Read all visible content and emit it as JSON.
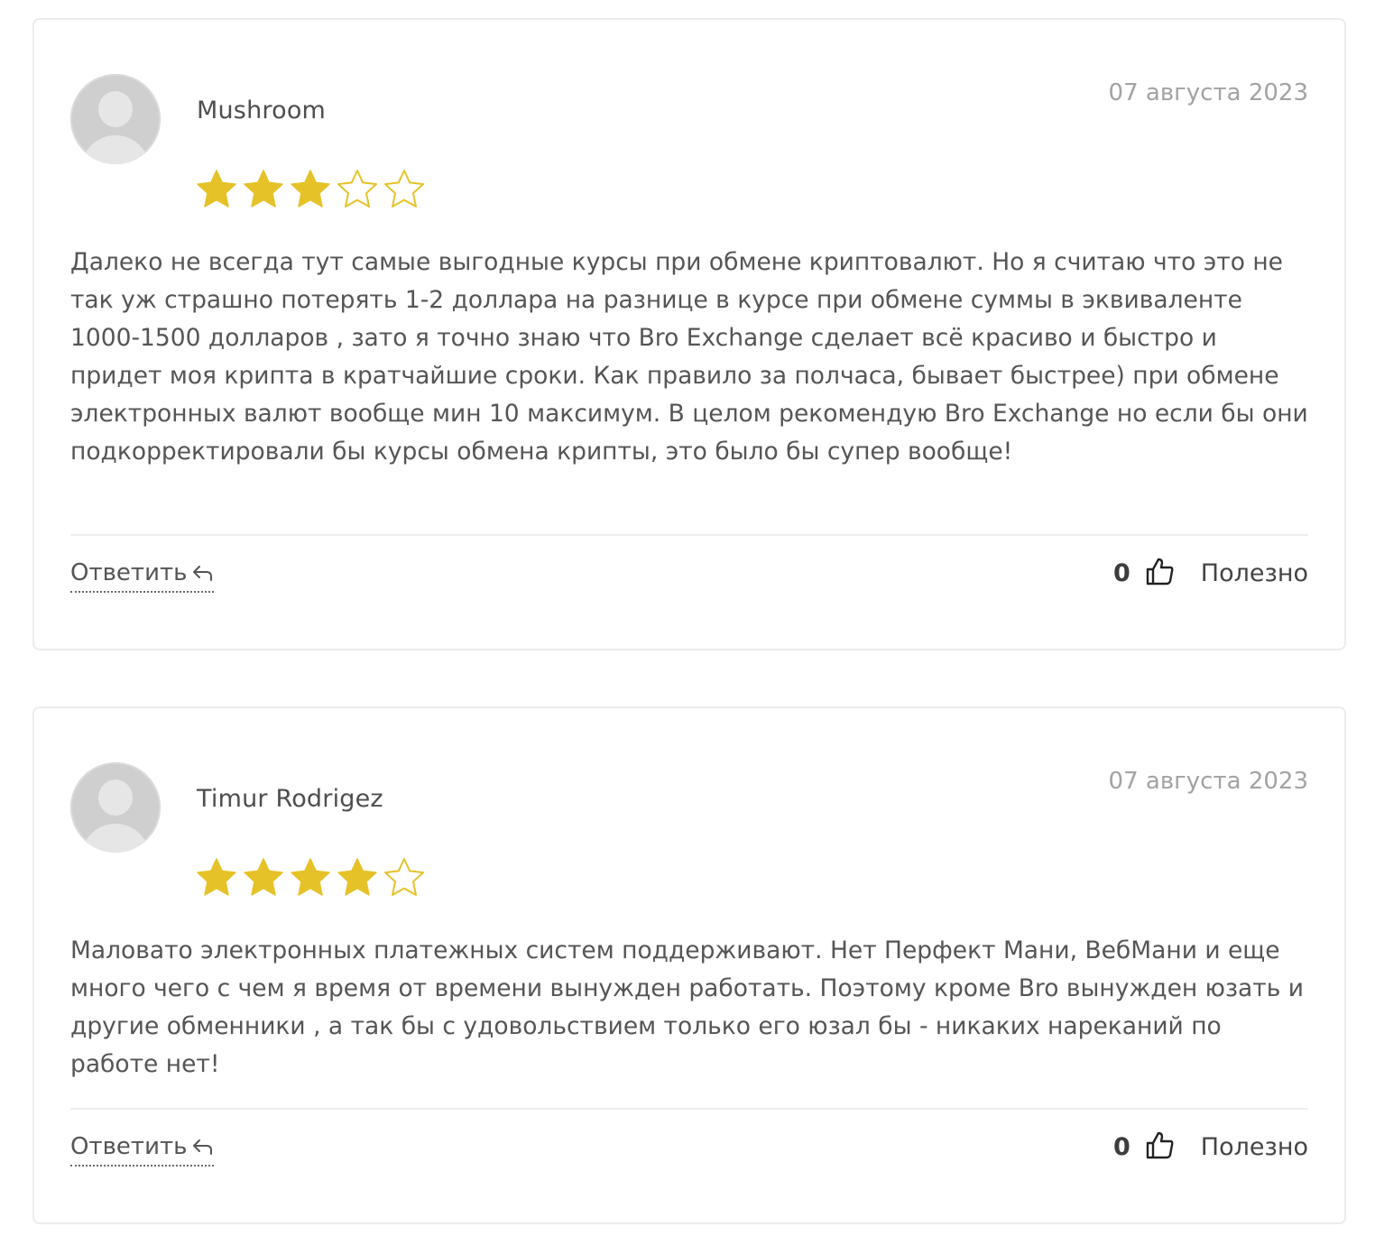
{
  "colors": {
    "star_filled": "#e6c229",
    "star_empty_stroke": "#e6c229",
    "date": "#a3a3a3",
    "card_border": "#ececec"
  },
  "reviews": [
    {
      "author": "Mushroom",
      "date": "07 августа 2023",
      "rating": 3,
      "max_rating": 5,
      "text": "Далеко не всегда тут самые выгодные курсы при обмене криптовалют. Но я считаю что это не так уж страшно потерять 1-2 доллара на разнице в курсе при обмене суммы в эквиваленте 1000-1500 долларов , зато я точно знаю что Bro Exchange сделает всё красиво и быстро и придет моя крипта в кратчайшие сроки. Как правило за полчаса, бывает быстрее) при обмене электронных валют вообще мин 10 максимум. В целом рекомендую Bro Exchange но если бы они подкорректировали бы курсы обмена крипты, это было бы супер вообще!",
      "reply_label": "Ответить",
      "reply_icon": "reply-arrow-icon",
      "useful_count": "0",
      "useful_icon": "thumbs-up-icon",
      "useful_label": "Полезно"
    },
    {
      "author": "Timur Rodrigez",
      "date": "07 августа 2023",
      "rating": 4,
      "max_rating": 5,
      "text": "Маловато электронных платежных систем поддерживают. Нет Перфект Мани, ВебМани и еще много чего с чем я время от времени вынужден работать. Поэтому кроме Bro вынужден юзать и другие обменники , а так бы с удовольствием только его юзал бы - никаких нареканий по работе нет!",
      "reply_label": "Ответить",
      "reply_icon": "reply-arrow-icon",
      "useful_count": "0",
      "useful_icon": "thumbs-up-icon",
      "useful_label": "Полезно"
    }
  ]
}
